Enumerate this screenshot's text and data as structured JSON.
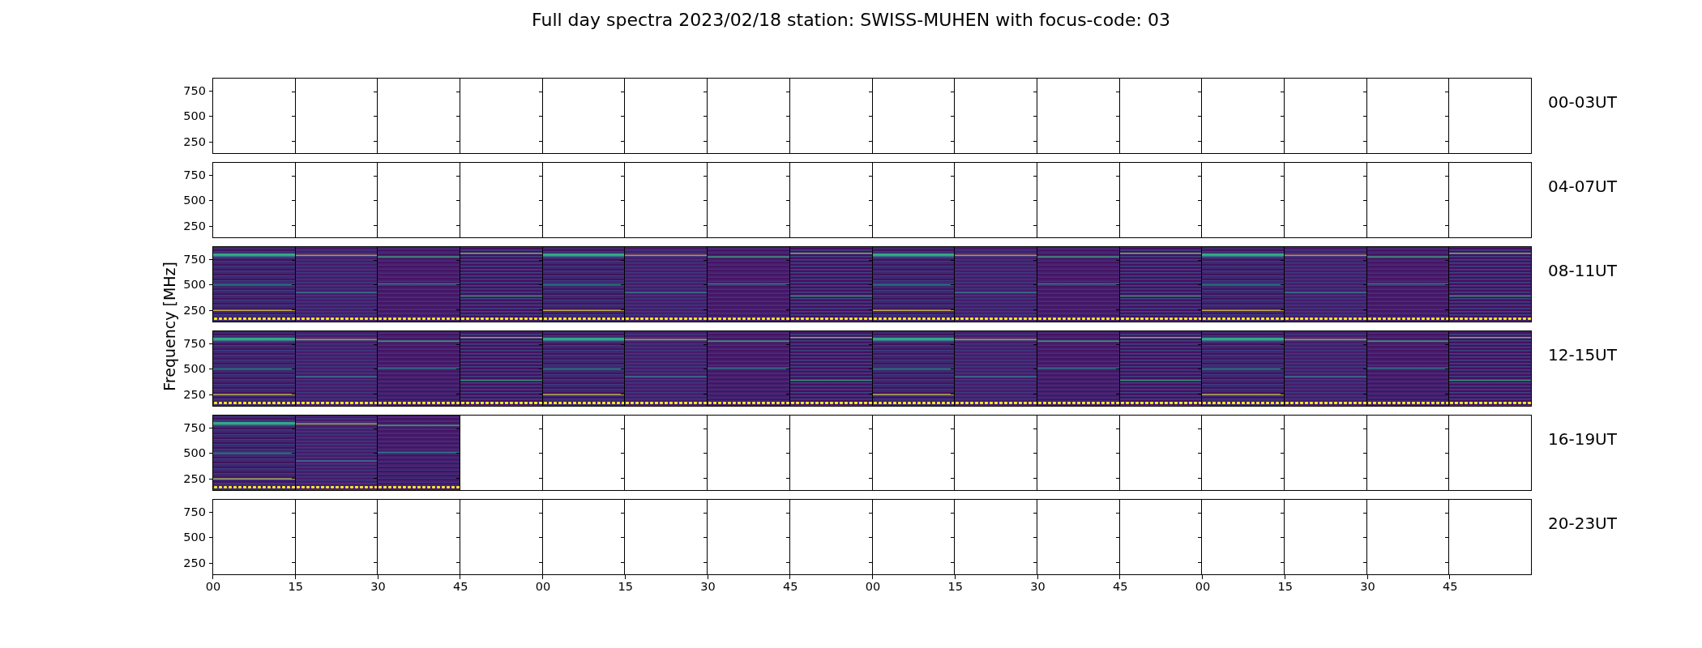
{
  "title": "Full day spectra 2023/02/18 station: SWISS-MUHEN with focus-code: 03",
  "ylabel": "Frequency [MHz]",
  "rows": [
    {
      "label": "00-03UT",
      "yticks": [
        "750",
        "500",
        "250"
      ],
      "panels": [
        {
          "data": false
        },
        {
          "data": false
        },
        {
          "data": false
        },
        {
          "data": false
        },
        {
          "data": false
        },
        {
          "data": false
        },
        {
          "data": false
        },
        {
          "data": false
        },
        {
          "data": false
        },
        {
          "data": false
        },
        {
          "data": false
        },
        {
          "data": false
        },
        {
          "data": false
        },
        {
          "data": false
        },
        {
          "data": false
        },
        {
          "data": false
        }
      ]
    },
    {
      "label": "04-07UT",
      "yticks": [
        "750",
        "500",
        "250"
      ],
      "panels": [
        {
          "data": false
        },
        {
          "data": false
        },
        {
          "data": false
        },
        {
          "data": false
        },
        {
          "data": false
        },
        {
          "data": false
        },
        {
          "data": false
        },
        {
          "data": false
        },
        {
          "data": false
        },
        {
          "data": false
        },
        {
          "data": false
        },
        {
          "data": false
        },
        {
          "data": false
        },
        {
          "data": false
        },
        {
          "data": false
        },
        {
          "data": false
        }
      ]
    },
    {
      "label": "08-11UT",
      "yticks": [
        "750",
        "500",
        "250"
      ],
      "panels": [
        {
          "data": true
        },
        {
          "data": true
        },
        {
          "data": true
        },
        {
          "data": true
        },
        {
          "data": true
        },
        {
          "data": true
        },
        {
          "data": true
        },
        {
          "data": true
        },
        {
          "data": true
        },
        {
          "data": true
        },
        {
          "data": true
        },
        {
          "data": true
        },
        {
          "data": true
        },
        {
          "data": true
        },
        {
          "data": true
        },
        {
          "data": true
        }
      ]
    },
    {
      "label": "12-15UT",
      "yticks": [
        "750",
        "500",
        "250"
      ],
      "panels": [
        {
          "data": true
        },
        {
          "data": true
        },
        {
          "data": true
        },
        {
          "data": true
        },
        {
          "data": true
        },
        {
          "data": true
        },
        {
          "data": true
        },
        {
          "data": true
        },
        {
          "data": true
        },
        {
          "data": true
        },
        {
          "data": true
        },
        {
          "data": true
        },
        {
          "data": true
        },
        {
          "data": true
        },
        {
          "data": true
        },
        {
          "data": true
        }
      ]
    },
    {
      "label": "16-19UT",
      "yticks": [
        "750",
        "500",
        "250"
      ],
      "panels": [
        {
          "data": true
        },
        {
          "data": true
        },
        {
          "data": true
        },
        {
          "data": false
        },
        {
          "data": false
        },
        {
          "data": false
        },
        {
          "data": false
        },
        {
          "data": false
        },
        {
          "data": false
        },
        {
          "data": false
        },
        {
          "data": false
        },
        {
          "data": false
        },
        {
          "data": false
        },
        {
          "data": false
        },
        {
          "data": false
        },
        {
          "data": false
        }
      ]
    },
    {
      "label": "20-23UT",
      "yticks": [
        "750",
        "500",
        "250"
      ],
      "panels": [
        {
          "data": false
        },
        {
          "data": false
        },
        {
          "data": false
        },
        {
          "data": false
        },
        {
          "data": false
        },
        {
          "data": false
        },
        {
          "data": false
        },
        {
          "data": false
        },
        {
          "data": false
        },
        {
          "data": false
        },
        {
          "data": false
        },
        {
          "data": false
        },
        {
          "data": false
        },
        {
          "data": false
        },
        {
          "data": false
        },
        {
          "data": false
        }
      ]
    }
  ],
  "xticks": [
    "00",
    "15",
    "30",
    "45",
    "00",
    "15",
    "30",
    "45",
    "00",
    "15",
    "30",
    "45",
    "00",
    "15",
    "30",
    "45"
  ]
}
